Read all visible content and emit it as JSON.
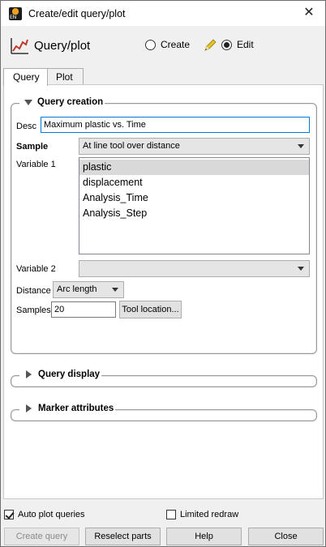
{
  "window": {
    "title": "Create/edit query/plot",
    "close_glyph": "✕",
    "icon_text": "EN"
  },
  "header": {
    "title": "Query/plot",
    "mode_options": [
      {
        "label": "Create",
        "selected": false
      },
      {
        "label": "Edit",
        "selected": true
      }
    ]
  },
  "tabs": [
    {
      "label": "Query",
      "active": true
    },
    {
      "label": "Plot",
      "active": false
    }
  ],
  "query_creation": {
    "title": "Query creation",
    "expanded": true,
    "desc_label": "Desc",
    "desc_value": "Maximum plastic vs. Time",
    "sample_label": "Sample",
    "sample_value": "At line tool over distance",
    "variable1_label": "Variable 1",
    "variable1_items": [
      {
        "label": "plastic",
        "selected": true
      },
      {
        "label": "displacement",
        "selected": false
      },
      {
        "label": "Analysis_Time",
        "selected": false
      },
      {
        "label": "Analysis_Step",
        "selected": false
      }
    ],
    "variable2_label": "Variable 2",
    "variable2_value": "",
    "distance_label": "Distance",
    "distance_value": "Arc length",
    "samples_label": "Samples",
    "samples_value": "20",
    "tool_location_label": "Tool location..."
  },
  "query_display": {
    "title": "Query display",
    "expanded": false
  },
  "marker_attributes": {
    "title": "Marker attributes",
    "expanded": false
  },
  "footer": {
    "auto_plot_label": "Auto plot queries",
    "auto_plot_checked": true,
    "limited_redraw_label": "Limited redraw",
    "limited_redraw_checked": false,
    "buttons": {
      "create_query": "Create query",
      "reselect_parts": "Reselect parts",
      "help": "Help",
      "close": "Close"
    }
  },
  "colors": {
    "focus_border": "#0078d7",
    "selected_item_bg": "#d9d9d9",
    "chart_icon_line": "#c0392b",
    "pencil": "#e2c02a"
  }
}
